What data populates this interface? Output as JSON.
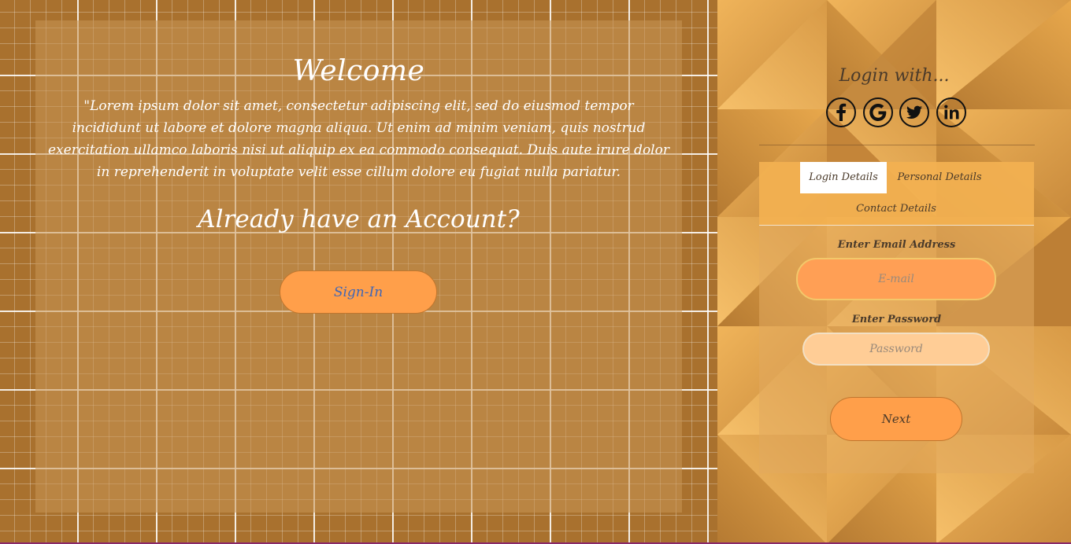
{
  "welcome": {
    "title": "Welcome",
    "text": "\"Lorem ipsum dolor sit amet, consectetur adipiscing elit, sed do eiusmod tempor incididunt ut labore et dolore magna aliqua. Ut enim ad minim veniam, quis nostrud exercitation ullamco laboris nisi ut aliquip ex ea commodo consequat. Duis aute irure dolor in reprehenderit in voluptate velit esse cillum dolore eu fugiat nulla pariatur.",
    "account_title": "Already have an Account?",
    "signin_label": "Sign-In"
  },
  "login": {
    "heading": "Login with...",
    "social": [
      "facebook-icon",
      "google-icon",
      "twitter-icon",
      "linkedin-icon"
    ]
  },
  "tabs": {
    "login_details": "Login Details",
    "personal_details": "Personal Details",
    "contact_details": "Contact Details"
  },
  "form": {
    "email_label": "Enter Email Address",
    "email_placeholder": "E-mail",
    "password_label": "Enter Password",
    "password_placeholder": "Password",
    "next_label": "Next"
  },
  "colors": {
    "accent": "#ff9f4a",
    "grid_bg": "#a9712e",
    "signin_text": "#3f66b7"
  }
}
